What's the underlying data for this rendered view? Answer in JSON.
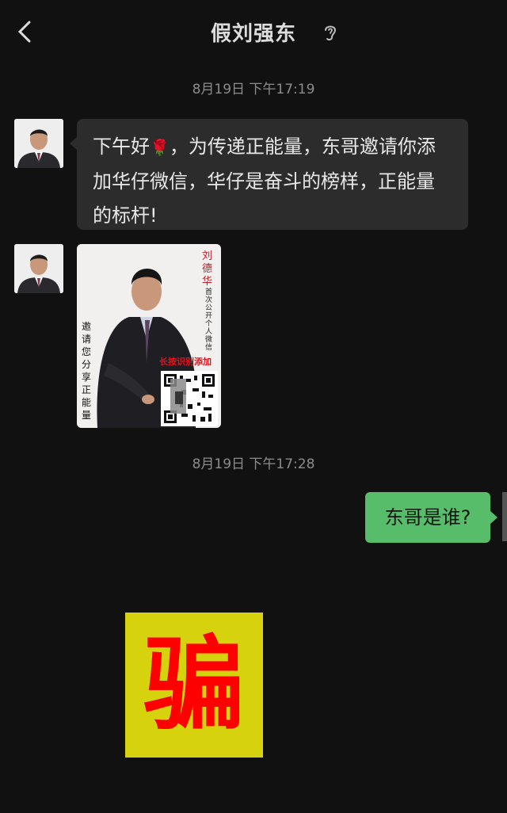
{
  "header": {
    "title": "假刘强东",
    "back_icon": "chevron-left-icon",
    "ear_icon": "ear-icon"
  },
  "messages": {
    "timestamp_1": "8月19日 下午17:19",
    "text_1_part1": "下午好",
    "text_1_emoji": "🌹",
    "text_1_part2": "，为传递正能量，东哥邀请你添加华仔微信，华仔是奋斗的榜样，正能量的标杆!",
    "timestamp_2": "8月19日 下午17:28",
    "reply": "东哥是谁?"
  },
  "poster": {
    "name": "刘德华",
    "subtitle": "首次公开个人微信",
    "badge": "长按识别添加",
    "invite": "邀请您分享正能量"
  },
  "overlay": {
    "label": "骗",
    "bg_color": "#d7d20e",
    "text_color": "#ff0000"
  }
}
